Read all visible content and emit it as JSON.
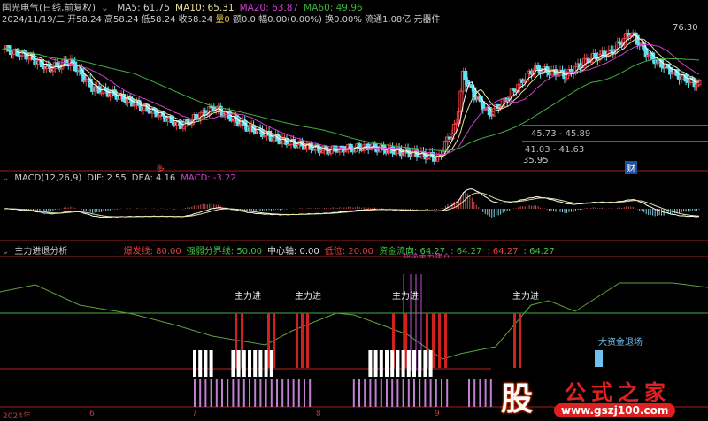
{
  "header": {
    "title": "国光电气(日线,前复权)",
    "ma5": "MA5: 61.75",
    "ma10": "MA10: 65.31",
    "ma20": "MA20: 63.87",
    "ma60": "MA60: 49.96",
    "info": "2024/11/19/二 开58.24 高58.24 低58.24 收58.24",
    "vol": "量0",
    "amt": "额0.0 幅0.00(0.00%) 换0.00% 流通1.08亿 元器件"
  },
  "price_labels": {
    "high": "76.30",
    "low": "35.95",
    "range1": "45.73 - 45.89",
    "range2": "41.03 - 41.63",
    "mark_duo": "多",
    "mark_cai": "财"
  },
  "macd": {
    "title": "MACD(12,26,9)",
    "dif": "DIF: 2.55",
    "dea": "DEA: 4.16",
    "macd": "MACD: -3.22"
  },
  "indicator": {
    "title": "主力进退分析",
    "l1": "爆发线: 80.00",
    "l2": "强弱分界线: 50.00",
    "l3": "中心轴: 0.00",
    "l4": "低位: 20.00",
    "l5": "资金流向: 64.27",
    "l6": ": 64.27",
    "l7": ": 64.27",
    "l8": ": 64.27",
    "top_label": "超级主力建仓",
    "enter_label": "主力进",
    "exit_label": "大资金退场"
  },
  "xaxis": [
    "2024年",
    "6",
    "7",
    "8",
    "9"
  ],
  "logo": {
    "text": "股",
    "name": "公式之家",
    "url": "www.gszj100.com"
  },
  "colors": {
    "up": "#e04040",
    "down": "#60e0f0",
    "ma5": "#ffffff",
    "ma10": "#e8e0a0",
    "ma20": "#d040d0",
    "ma60": "#40b040"
  },
  "chart_data": {
    "type": "candlestick",
    "price_keypoints": [
      [
        0,
        70
      ],
      [
        10,
        68
      ],
      [
        20,
        64
      ],
      [
        30,
        66
      ],
      [
        40,
        58
      ],
      [
        50,
        56
      ],
      [
        60,
        53
      ],
      [
        70,
        50
      ],
      [
        80,
        46.5
      ],
      [
        95,
        52
      ],
      [
        110,
        46
      ],
      [
        125,
        42
      ],
      [
        145,
        39
      ],
      [
        165,
        40
      ],
      [
        190,
        37.5
      ],
      [
        197,
        36.5
      ],
      [
        200,
        41
      ],
      [
        205,
        47
      ],
      [
        208,
        62
      ],
      [
        213,
        56
      ],
      [
        220,
        50
      ],
      [
        228,
        55
      ],
      [
        240,
        64
      ],
      [
        255,
        62
      ],
      [
        265,
        67
      ],
      [
        275,
        69
      ],
      [
        284,
        75
      ],
      [
        292,
        68
      ],
      [
        305,
        62
      ],
      [
        315,
        59
      ]
    ],
    "ylim": [
      35.95,
      76.3
    ]
  }
}
